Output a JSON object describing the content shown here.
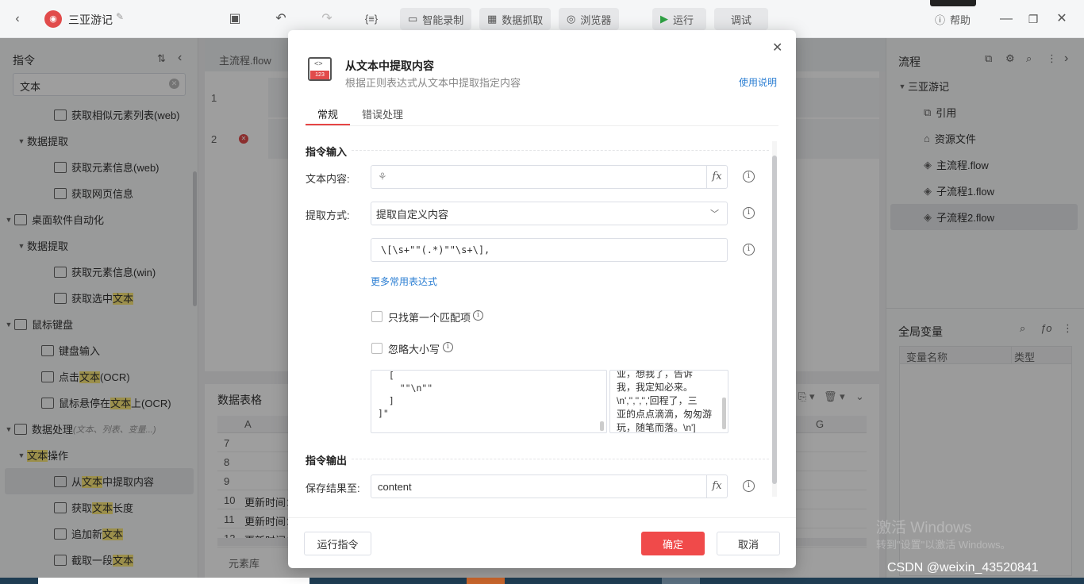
{
  "titlebar": {
    "app_title": "三亚游记",
    "btn_record": "智能录制",
    "btn_extract": "数据抓取",
    "btn_browser": "浏览器",
    "btn_run": "运行",
    "btn_debug": "调试",
    "btn_help": "帮助"
  },
  "left": {
    "title": "指令",
    "search_value": "文本",
    "items": [
      {
        "label_pre": "获取相似元素列表(web)",
        "hl": "",
        "label_post": ""
      },
      {
        "label_pre": "数据提取",
        "hl": "",
        "label_post": ""
      },
      {
        "label_pre": "获取元素信息(web)",
        "hl": "",
        "label_post": ""
      },
      {
        "label_pre": "获取网页信息",
        "hl": "",
        "label_post": ""
      },
      {
        "label_pre": "桌面软件自动化",
        "hl": "",
        "label_post": ""
      },
      {
        "label_pre": "数据提取",
        "hl": "",
        "label_post": ""
      },
      {
        "label_pre": "获取元素信息(win)",
        "hl": "",
        "label_post": ""
      },
      {
        "label_pre": "获取选中",
        "hl": "文本",
        "label_post": ""
      },
      {
        "label_pre": "鼠标键盘",
        "hl": "",
        "label_post": ""
      },
      {
        "label_pre": "键盘输入",
        "hl": "",
        "label_post": ""
      },
      {
        "label_pre": "点击",
        "hl": "文本",
        "label_post": "(OCR)"
      },
      {
        "label_pre": "鼠标悬停在",
        "hl": "文本",
        "label_post": "上(OCR)"
      },
      {
        "label_pre": "数据处理",
        "hl": "",
        "label_post": "",
        "note": "(文本、列表、变量...)"
      },
      {
        "label_pre": "",
        "hl": "文本",
        "label_post": "操作"
      },
      {
        "label_pre": "从",
        "hl": "文本",
        "label_post": "中提取内容"
      },
      {
        "label_pre": "获取",
        "hl": "文本",
        "label_post": "长度"
      },
      {
        "label_pre": "追加新",
        "hl": "文本",
        "label_post": ""
      },
      {
        "label_pre": "截取一段",
        "hl": "文本",
        "label_post": ""
      }
    ]
  },
  "editor": {
    "tab": "主流程.flow",
    "line1": "1",
    "line2": "2"
  },
  "datatable": {
    "title": "数据表格",
    "col_a": "A",
    "col_g": "G",
    "rows": [
      {
        "num": "7",
        "val": ""
      },
      {
        "num": "8",
        "val": ""
      },
      {
        "num": "9",
        "val": ""
      },
      {
        "num": "10",
        "val": "更新时间："
      },
      {
        "num": "11",
        "val": "更新时间："
      },
      {
        "num": "12",
        "val": "更新时间："
      }
    ],
    "bottom_tab": "元素库"
  },
  "right": {
    "flow_title": "流程",
    "project": "三亚游记",
    "items": [
      "引用",
      "资源文件",
      "主流程.flow",
      "子流程1.flow",
      "子流程2.flow"
    ],
    "vars_title": "全局变量",
    "col_name": "变量名称",
    "col_type": "类型"
  },
  "dialog": {
    "title": "从文本中提取内容",
    "subtitle": "根据正则表达式从文本中提取指定内容",
    "usage_link": "使用说明",
    "tab_general": "常规",
    "tab_error": "错误处理",
    "section_input": "指令输入",
    "label_text": "文本内容:",
    "text_value": "",
    "label_method": "提取方式:",
    "method_value": "提取自定义内容",
    "regex_value": "\\[\\s+\"\"(.*)\"\"\\s+\\],",
    "more_regex": "更多常用表达式",
    "opt_first": "只找第一个匹配项",
    "opt_ignorecase": "忽略大小写",
    "preview_left": [
      "  [",
      "    \"\"\\n\"\"",
      "  ]",
      "]\""
    ],
    "preview_right": [
      "业，想我了，告诉",
      "我，我定知必来。",
      "\\n','','','','回程了，三",
      "亚的点点滴滴，匆匆游",
      "玩，随笔而落。\\n']"
    ],
    "section_output": "指令输出",
    "label_save": "保存结果至:",
    "save_value": "content",
    "btn_run_cmd": "运行指令",
    "btn_ok": "确定",
    "btn_cancel": "取消"
  },
  "watermark": {
    "activate_title": "激活 Windows",
    "activate_sub": "转到\"设置\"以激活 Windows。",
    "csdn": "CSDN @weixin_43520841"
  },
  "colors": {
    "accent_red": "#f04a4a",
    "link_blue": "#2d7fd3",
    "tab_underline": "#e64545"
  }
}
